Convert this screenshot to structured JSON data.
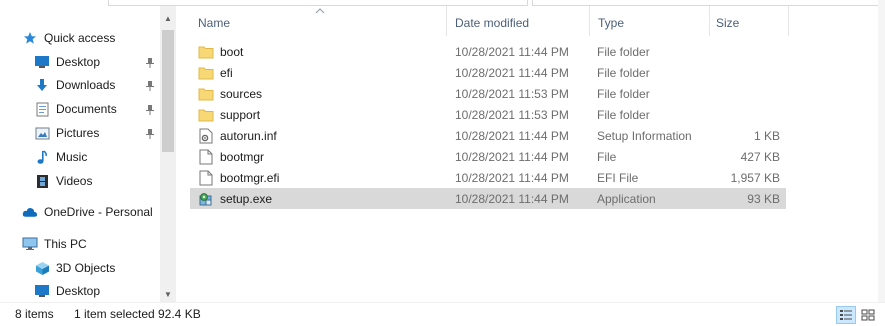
{
  "navigation": {
    "items": [
      {
        "label": "Quick access",
        "icon": "star-icon"
      },
      {
        "label": "Desktop",
        "icon": "desktop-icon",
        "pinned": true
      },
      {
        "label": "Downloads",
        "icon": "download-arrow-icon",
        "pinned": true
      },
      {
        "label": "Documents",
        "icon": "documents-icon",
        "pinned": true
      },
      {
        "label": "Pictures",
        "icon": "pictures-icon",
        "pinned": true
      },
      {
        "label": "Music",
        "icon": "music-note-icon"
      },
      {
        "label": "Videos",
        "icon": "film-icon"
      },
      {
        "label": "OneDrive - Personal",
        "icon": "cloud-icon"
      },
      {
        "label": "This PC",
        "icon": "computer-icon"
      },
      {
        "label": "3D Objects",
        "icon": "cube-icon"
      },
      {
        "label": "Desktop",
        "icon": "desktop-icon"
      }
    ]
  },
  "columns": {
    "name": "Name",
    "date_modified": "Date modified",
    "type": "Type",
    "size": "Size"
  },
  "files": [
    {
      "name": "boot",
      "date": "10/28/2021 11:44 PM",
      "type": "File folder",
      "size": "",
      "icon": "folder-icon"
    },
    {
      "name": "efi",
      "date": "10/28/2021 11:44 PM",
      "type": "File folder",
      "size": "",
      "icon": "folder-icon"
    },
    {
      "name": "sources",
      "date": "10/28/2021 11:53 PM",
      "type": "File folder",
      "size": "",
      "icon": "folder-icon"
    },
    {
      "name": "support",
      "date": "10/28/2021 11:53 PM",
      "type": "File folder",
      "size": "",
      "icon": "folder-icon"
    },
    {
      "name": "autorun.inf",
      "date": "10/28/2021 11:44 PM",
      "type": "Setup Information",
      "size": "1 KB",
      "icon": "settings-file-icon"
    },
    {
      "name": "bootmgr",
      "date": "10/28/2021 11:44 PM",
      "type": "File",
      "size": "427 KB",
      "icon": "file-icon"
    },
    {
      "name": "bootmgr.efi",
      "date": "10/28/2021 11:44 PM",
      "type": "EFI File",
      "size": "1,957 KB",
      "icon": "file-icon"
    },
    {
      "name": "setup.exe",
      "date": "10/28/2021 11:44 PM",
      "type": "Application",
      "size": "93 KB",
      "icon": "setup-app-icon",
      "selected": true
    }
  ],
  "status": {
    "item_count": "8 items",
    "selection": "1 item selected",
    "selection_size": "92.4 KB"
  },
  "colors": {
    "selection_bg": "#d9d9d9",
    "folder": "#f8d775",
    "accent": "#0078d7"
  }
}
